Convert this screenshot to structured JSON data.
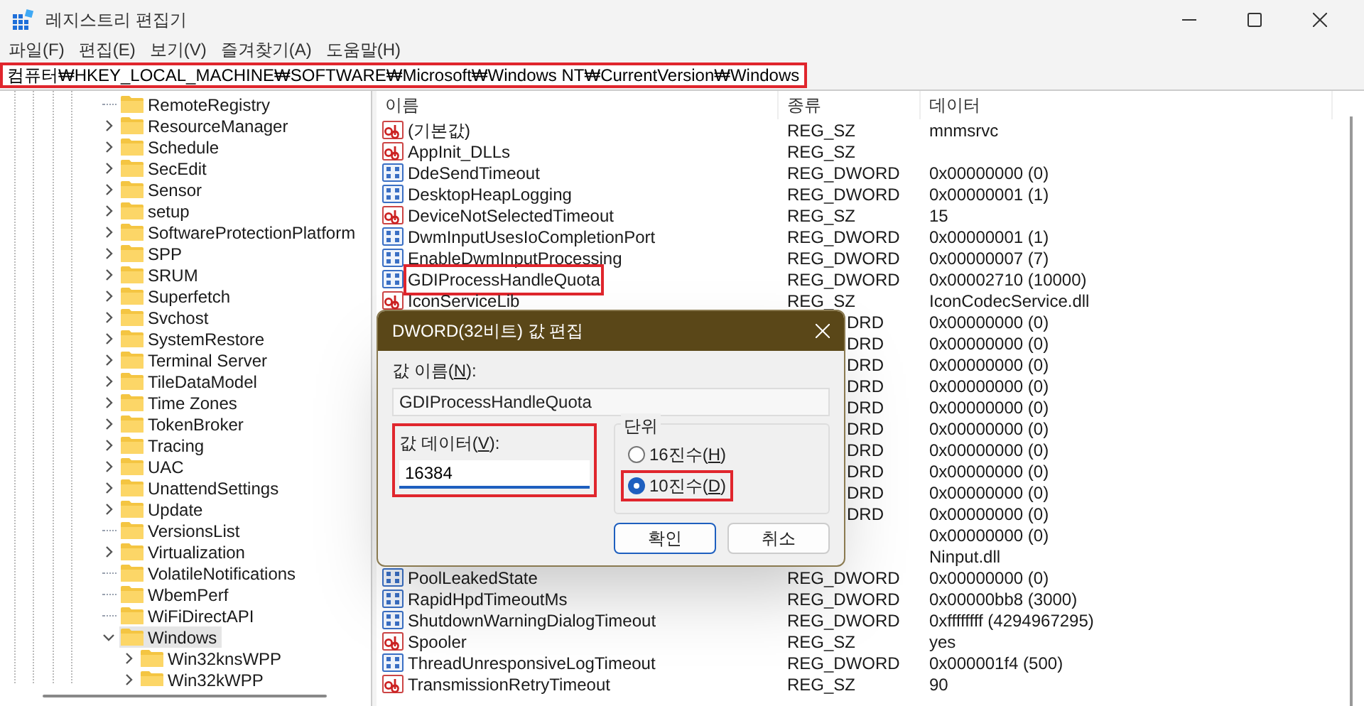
{
  "window": {
    "title": "레지스트리 편집기"
  },
  "menu": [
    "파일(F)",
    "편집(E)",
    "보기(V)",
    "즐겨찾기(A)",
    "도움말(H)"
  ],
  "address": {
    "value": "컴퓨터₩HKEY_LOCAL_MACHINE₩SOFTWARE₩Microsoft₩Windows NT₩CurrentVersion₩Windows",
    "highlighted": true
  },
  "tree": {
    "items": [
      {
        "name": "RemoteRegistry",
        "has_children": false,
        "expanded": false,
        "selected": false
      },
      {
        "name": "ResourceManager",
        "has_children": true,
        "expanded": false,
        "selected": false
      },
      {
        "name": "Schedule",
        "has_children": true,
        "expanded": false,
        "selected": false
      },
      {
        "name": "SecEdit",
        "has_children": true,
        "expanded": false,
        "selected": false
      },
      {
        "name": "Sensor",
        "has_children": true,
        "expanded": false,
        "selected": false
      },
      {
        "name": "setup",
        "has_children": true,
        "expanded": false,
        "selected": false
      },
      {
        "name": "SoftwareProtectionPlatform",
        "has_children": true,
        "expanded": false,
        "selected": false
      },
      {
        "name": "SPP",
        "has_children": true,
        "expanded": false,
        "selected": false
      },
      {
        "name": "SRUM",
        "has_children": true,
        "expanded": false,
        "selected": false
      },
      {
        "name": "Superfetch",
        "has_children": true,
        "expanded": false,
        "selected": false
      },
      {
        "name": "Svchost",
        "has_children": true,
        "expanded": false,
        "selected": false
      },
      {
        "name": "SystemRestore",
        "has_children": true,
        "expanded": false,
        "selected": false
      },
      {
        "name": "Terminal Server",
        "has_children": true,
        "expanded": false,
        "selected": false
      },
      {
        "name": "TileDataModel",
        "has_children": true,
        "expanded": false,
        "selected": false
      },
      {
        "name": "Time Zones",
        "has_children": true,
        "expanded": false,
        "selected": false
      },
      {
        "name": "TokenBroker",
        "has_children": true,
        "expanded": false,
        "selected": false
      },
      {
        "name": "Tracing",
        "has_children": true,
        "expanded": false,
        "selected": false
      },
      {
        "name": "UAC",
        "has_children": true,
        "expanded": false,
        "selected": false
      },
      {
        "name": "UnattendSettings",
        "has_children": true,
        "expanded": false,
        "selected": false
      },
      {
        "name": "Update",
        "has_children": true,
        "expanded": false,
        "selected": false
      },
      {
        "name": "VersionsList",
        "has_children": false,
        "expanded": false,
        "selected": false
      },
      {
        "name": "Virtualization",
        "has_children": true,
        "expanded": false,
        "selected": false
      },
      {
        "name": "VolatileNotifications",
        "has_children": false,
        "expanded": false,
        "selected": false
      },
      {
        "name": "WbemPerf",
        "has_children": false,
        "expanded": false,
        "selected": false
      },
      {
        "name": "WiFiDirectAPI",
        "has_children": false,
        "expanded": false,
        "selected": false
      },
      {
        "name": "Windows",
        "has_children": true,
        "expanded": true,
        "selected": true,
        "children": [
          {
            "name": "Win32knsWPP",
            "has_children": true,
            "expanded": false,
            "selected": false
          },
          {
            "name": "Win32kWPP",
            "has_children": true,
            "expanded": false,
            "selected": false
          }
        ]
      }
    ]
  },
  "table": {
    "columns": [
      "이름",
      "종류",
      "데이터"
    ],
    "rows": [
      {
        "kind": "sz",
        "name": "(기본값)",
        "type": "REG_SZ",
        "data": "mnmsrvc",
        "highlighted": false
      },
      {
        "kind": "sz",
        "name": "AppInit_DLLs",
        "type": "REG_SZ",
        "highlighted": false
      },
      {
        "kind": "dword",
        "name": "DdeSendTimeout",
        "type": "REG_DWORD",
        "data": "0x00000000 (0)",
        "highlighted": false
      },
      {
        "kind": "dword",
        "name": "DesktopHeapLogging",
        "type": "REG_DWORD",
        "data": "0x00000001 (1)",
        "highlighted": false
      },
      {
        "kind": "sz",
        "name": "DeviceNotSelectedTimeout",
        "type": "REG_SZ",
        "data": "15",
        "highlighted": false
      },
      {
        "kind": "dword",
        "name": "DwmInputUsesIoCompletionPort",
        "type": "REG_DWORD",
        "data": "0x00000001 (1)",
        "highlighted": false
      },
      {
        "kind": "dword",
        "name": "EnableDwmInputProcessing",
        "type": "REG_DWORD",
        "data": "0x00000007 (7)",
        "highlighted": false
      },
      {
        "kind": "dword",
        "name": "GDIProcessHandleQuota",
        "type": "REG_DWORD",
        "data": "0x00002710 (10000)",
        "highlighted": true
      },
      {
        "kind": "sz",
        "name": "IconServiceLib",
        "type": "REG_SZ",
        "data": "IconCodecService.dll",
        "highlighted": false
      },
      {
        "kind": "covered",
        "type": "DRD",
        "data": "0x00000000 (0)"
      },
      {
        "kind": "covered",
        "type": "DRD",
        "data": "0x00000000 (0)"
      },
      {
        "kind": "covered",
        "type": "DRD",
        "data": "0x00000000 (0)"
      },
      {
        "kind": "covered",
        "type": "DRD",
        "data": "0x00000000 (0)"
      },
      {
        "kind": "covered",
        "type": "DRD",
        "data": "0x00000000 (0)"
      },
      {
        "kind": "covered",
        "type": "DRD",
        "data": "0x00000000 (0)"
      },
      {
        "kind": "covered",
        "type": "DRD",
        "data": "0x00000000 (0)"
      },
      {
        "kind": "covered",
        "type": "DRD",
        "data": "0x00000000 (0)"
      },
      {
        "kind": "covered",
        "type": "DRD",
        "data": "0x00000000 (0)"
      },
      {
        "kind": "covered",
        "type": "DRD",
        "data": "0x00000000 (0)"
      },
      {
        "kind": "covered",
        "data": "0x00000000 (0)"
      },
      {
        "kind": "covered",
        "data": "Ninput.dll"
      },
      {
        "kind": "dword",
        "name": "PoolLeakedState",
        "type": "REG_DWORD",
        "data": "0x00000000 (0)",
        "highlighted": false
      },
      {
        "kind": "dword",
        "name": "RapidHpdTimeoutMs",
        "type": "REG_DWORD",
        "data": "0x00000bb8 (3000)",
        "highlighted": false
      },
      {
        "kind": "dword",
        "name": "ShutdownWarningDialogTimeout",
        "type": "REG_DWORD",
        "data": "0xffffffff (4294967295)",
        "highlighted": false
      },
      {
        "kind": "sz",
        "name": "Spooler",
        "type": "REG_SZ",
        "data": "yes",
        "highlighted": false
      },
      {
        "kind": "dword",
        "name": "ThreadUnresponsiveLogTimeout",
        "type": "REG_DWORD",
        "data": "0x000001f4 (500)",
        "highlighted": false
      },
      {
        "kind": "sz",
        "name": "TransmissionRetryTimeout",
        "type": "REG_SZ",
        "data": "90",
        "highlighted": false
      }
    ]
  },
  "dialog": {
    "title": "DWORD(32비트) 값 편집",
    "name_label": {
      "before": "값 이름(",
      "key": "N",
      "after": "):"
    },
    "name_value": "GDIProcessHandleQuota",
    "data_label": {
      "before": "값 데이터(",
      "key": "V",
      "after": "):"
    },
    "data_value": "16384",
    "data_highlighted": true,
    "base_group": "단위",
    "radios": [
      {
        "before": "16진수(",
        "key": "H",
        "after": ")",
        "selected": false,
        "highlighted": false
      },
      {
        "before": "10진수(",
        "key": "D",
        "after": ")",
        "selected": true,
        "highlighted": true
      }
    ],
    "buttons": [
      {
        "label": "확인",
        "default": true
      },
      {
        "label": "취소",
        "default": false
      }
    ]
  }
}
